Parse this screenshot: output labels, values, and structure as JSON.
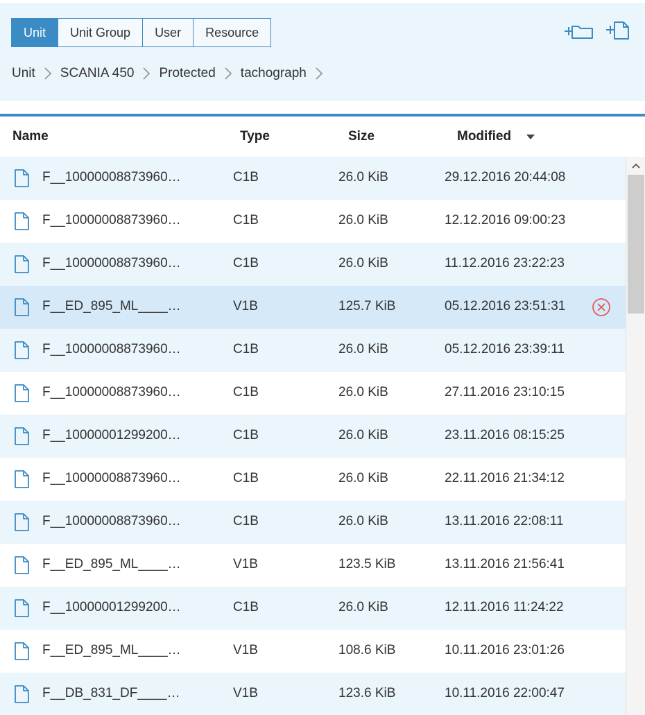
{
  "tabs": [
    {
      "label": "Unit",
      "active": true
    },
    {
      "label": "Unit Group",
      "active": false
    },
    {
      "label": "User",
      "active": false
    },
    {
      "label": "Resource",
      "active": false
    }
  ],
  "breadcrumb": [
    "Unit",
    "SCANIA 450",
    "Protected",
    "tachograph"
  ],
  "toolbar": {
    "new_folder_icon": "add-folder-icon",
    "new_file_icon": "add-file-icon"
  },
  "table": {
    "headers": {
      "name": "Name",
      "type": "Type",
      "size": "Size",
      "modified": "Modified"
    },
    "sort": {
      "column": "modified",
      "direction": "descending"
    },
    "rows": [
      {
        "name": "F__10000008873960…",
        "type": "C1B",
        "size": "26.0 KiB",
        "modified": "29.12.2016 20:44:08"
      },
      {
        "name": "F__10000008873960…",
        "type": "C1B",
        "size": "26.0 KiB",
        "modified": "12.12.2016 09:00:23"
      },
      {
        "name": "F__10000008873960…",
        "type": "C1B",
        "size": "26.0 KiB",
        "modified": "11.12.2016 23:22:23"
      },
      {
        "name": "F__ED_895_ML____…",
        "type": "V1B",
        "size": "125.7 KiB",
        "modified": "05.12.2016 23:51:31",
        "selected": true
      },
      {
        "name": "F__10000008873960…",
        "type": "C1B",
        "size": "26.0 KiB",
        "modified": "05.12.2016 23:39:11"
      },
      {
        "name": "F__10000008873960…",
        "type": "C1B",
        "size": "26.0 KiB",
        "modified": "27.11.2016 23:10:15"
      },
      {
        "name": "F__10000001299200…",
        "type": "C1B",
        "size": "26.0 KiB",
        "modified": "23.11.2016 08:15:25"
      },
      {
        "name": "F__10000008873960…",
        "type": "C1B",
        "size": "26.0 KiB",
        "modified": "22.11.2016 21:34:12"
      },
      {
        "name": "F__10000008873960…",
        "type": "C1B",
        "size": "26.0 KiB",
        "modified": "13.11.2016 22:08:11"
      },
      {
        "name": "F__ED_895_ML____…",
        "type": "V1B",
        "size": "123.5 KiB",
        "modified": "13.11.2016 21:56:41"
      },
      {
        "name": "F__10000001299200…",
        "type": "C1B",
        "size": "26.0 KiB",
        "modified": "12.11.2016 11:24:22"
      },
      {
        "name": "F__ED_895_ML____…",
        "type": "V1B",
        "size": "108.6 KiB",
        "modified": "10.11.2016 23:01:26"
      },
      {
        "name": "F__DB_831_DF____…",
        "type": "V1B",
        "size": "123.6 KiB",
        "modified": "10.11.2016 22:00:47"
      }
    ]
  },
  "colors": {
    "accent": "#3b8bc4",
    "row_alt": "#eaf5fc",
    "row_selected": "#d6e9f8",
    "delete": "#e05a5a"
  }
}
